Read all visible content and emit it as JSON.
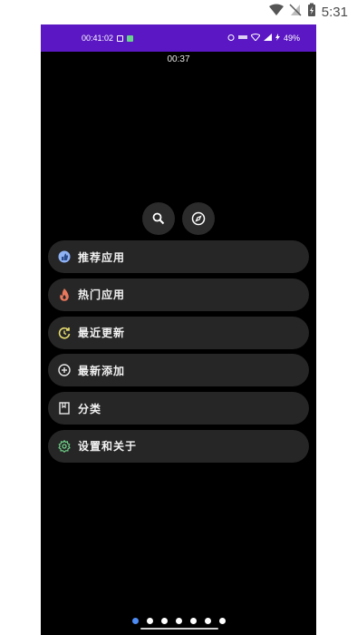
{
  "host_status": {
    "time": "5:31",
    "icons": [
      "wifi-icon",
      "no-sim-icon",
      "battery-icon"
    ]
  },
  "device_status": {
    "time": "00:41:02",
    "battery": "49%",
    "icons_left": [
      "screen-record-icon",
      "message-icon"
    ],
    "icons_right": [
      "alarm-icon",
      "data-icon",
      "wifi-icon",
      "signal-icon",
      "charging-icon"
    ]
  },
  "clock": "00:37",
  "actions": {
    "search_icon": "search-icon",
    "explore_icon": "compass-icon"
  },
  "menu": [
    {
      "label": "推荐应用",
      "icon": "thumbs-up-icon",
      "color": "#8fb2f4"
    },
    {
      "label": "热门应用",
      "icon": "fire-icon",
      "color": "#e8775b"
    },
    {
      "label": "最近更新",
      "icon": "refresh-icon",
      "color": "#e7de6e"
    },
    {
      "label": "最新添加",
      "icon": "plus-circle-icon",
      "color": "#e8e8e8"
    },
    {
      "label": "分类",
      "icon": "book-icon",
      "color": "#e8e8e8"
    },
    {
      "label": "设置和关于",
      "icon": "settings-icon",
      "color": "#6fd089"
    }
  ],
  "pager": {
    "count": 7,
    "active_index": 0,
    "active_color": "#4d8cf5"
  }
}
